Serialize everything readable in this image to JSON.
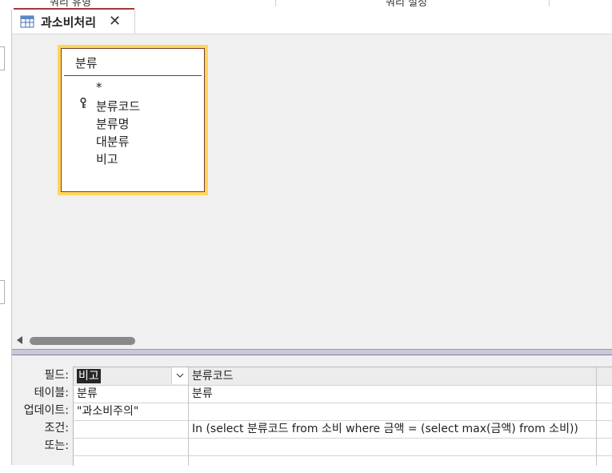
{
  "ribbon": {
    "group1_label": "쿼리 유형",
    "group2_label": "쿼리 설정"
  },
  "tab": {
    "title": "과소비처리",
    "close_glyph": "✕"
  },
  "table_box": {
    "title": "분류",
    "fields": [
      "*",
      "분류코드",
      "분류명",
      "대분류",
      "비고"
    ]
  },
  "grid": {
    "row_labels": [
      "필드:",
      "테이블:",
      "업데이트:",
      "조건:",
      "또는:"
    ],
    "columns": [
      {
        "field": "비고",
        "table": "분류",
        "update": "\"과소비주의\"",
        "criteria": "",
        "or": ""
      },
      {
        "field": "분류코드",
        "table": "분류",
        "update": "",
        "criteria": "In (select 분류코드 from 소비 where 금액 = (select max(금액) from 소비))",
        "or": ""
      }
    ]
  },
  "colors": {
    "accent": "#a4373a",
    "table_highlight": "#ffd65c",
    "selection": "#262626"
  }
}
